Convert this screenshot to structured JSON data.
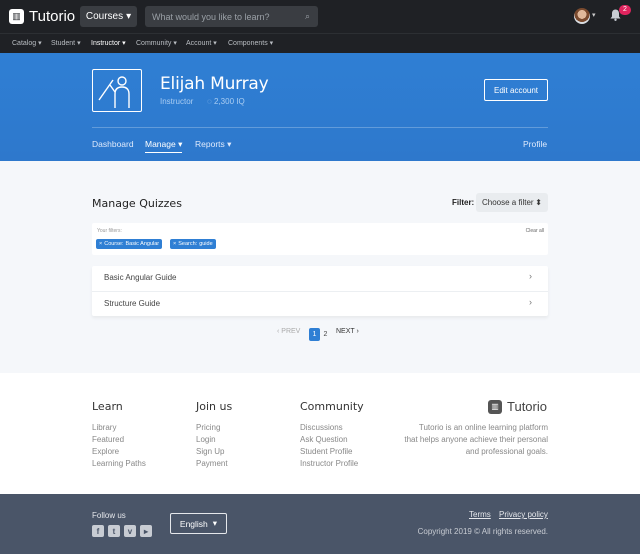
{
  "brand": {
    "name": "Tutorio"
  },
  "topbar": {
    "courses_label": "Courses",
    "search_placeholder": "What would you like to learn?",
    "notification_count": "2"
  },
  "subnav": [
    "Catalog",
    "Student",
    "Instructor",
    "Community",
    "Account",
    "Components"
  ],
  "profile": {
    "name": "Elijah Murray",
    "role": "Instructor",
    "iq": "2,300 IQ",
    "edit_label": "Edit account"
  },
  "hero_nav": {
    "dashboard": "Dashboard",
    "manage": "Manage",
    "reports": "Reports",
    "profile": "Profile"
  },
  "main": {
    "title": "Manage Quizzes",
    "filter_label": "Filter:",
    "filter_value": "Choose a filter",
    "your_filters": "Your filters:",
    "clear_all": "Clear all",
    "chips": [
      {
        "key": "Course:",
        "value": "Basic Angular"
      },
      {
        "key": "Search:",
        "value": "guide"
      }
    ],
    "quizzes": [
      "Basic Angular Guide",
      "Structure Guide"
    ],
    "pager": {
      "prev": "PREV",
      "pages": [
        "1",
        "2"
      ],
      "next": "NEXT",
      "current": "1"
    }
  },
  "footer": {
    "learn": {
      "title": "Learn",
      "links": [
        "Library",
        "Featured",
        "Explore",
        "Learning Paths"
      ]
    },
    "join": {
      "title": "Join us",
      "links": [
        "Pricing",
        "Login",
        "Sign Up",
        "Payment"
      ]
    },
    "community": {
      "title": "Community",
      "links": [
        "Discussions",
        "Ask Question",
        "Student Profile",
        "Instructor Profile"
      ]
    },
    "description": [
      "Tutorio is an online learning platform",
      "that helps anyone achieve their personal",
      "and professional goals."
    ],
    "follow": "Follow us",
    "language": "English",
    "terms": "Terms",
    "privacy": "Privacy policy",
    "copyright": "Copyright 2019 © All rights reserved."
  },
  "colors": {
    "primary": "#2f7fd4",
    "dark": "#1f2125",
    "footer": "#4a5568",
    "badge": "#e0245e"
  }
}
